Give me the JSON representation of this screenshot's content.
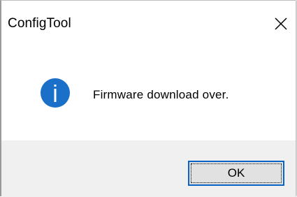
{
  "window": {
    "title": "ConfigTool",
    "close_icon": "close-icon"
  },
  "message": {
    "icon": "info-icon",
    "text": "Firmware download over."
  },
  "footer": {
    "ok_label": "OK"
  },
  "colors": {
    "info_blue": "#1a6fc9",
    "button_border": "#0a64c8",
    "footer_bg": "#f0f0f0"
  }
}
